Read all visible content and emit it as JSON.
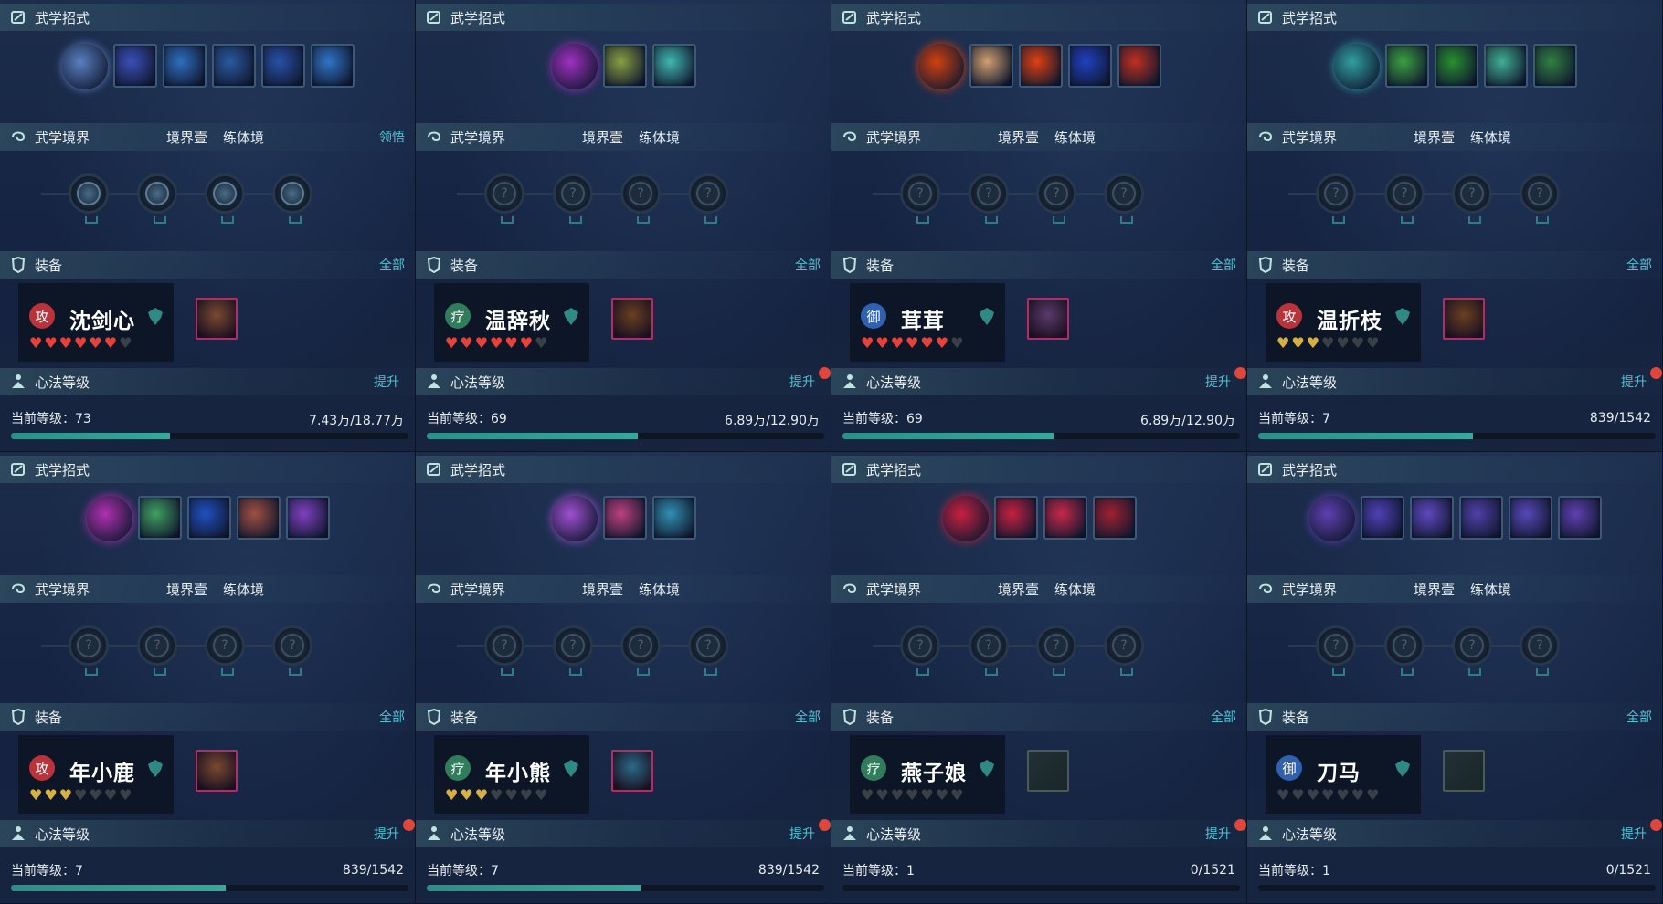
{
  "labels": {
    "wuxue_zhaoshi": "武学招式",
    "wuxue_jingjie": "武学境界",
    "realm_level": "境界壹",
    "realm_type": "练体境",
    "equipment": "装备",
    "all_link": "全部",
    "xinfa": "心法等级",
    "upgrade": "提升",
    "current_level_prefix": "当前等级："
  },
  "panels": [
    {
      "jingjie_link": "领悟",
      "skills": [
        "#5a7fc0",
        "#3b4fb8",
        "#2e6fc0",
        "#2a5aa0",
        "#2850a8",
        "#3075c8"
      ],
      "skill_icons": [
        "vortex-icon",
        "slash-icon",
        "whirl-icon",
        "blade-icon",
        "sword-icon",
        "strike-icon"
      ],
      "realm_nodes_unlocked": true,
      "character": {
        "name": "沈剑心",
        "badge": "攻",
        "badge_color": "#b8333a",
        "hearts": 6,
        "heart_total": 7,
        "heart_color": "#e8403a"
      },
      "gear_color": "#7a4a30",
      "level": "73",
      "exp": "7.43万/18.77万",
      "progress": 0.4,
      "red_dot": false
    },
    {
      "jingjie_link": "",
      "skills": [
        "#a030c0",
        "#88a040",
        "#40b8b0"
      ],
      "skill_icons": [
        "aura-icon",
        "burst-icon",
        "ring-icon"
      ],
      "realm_nodes_unlocked": false,
      "character": {
        "name": "温辞秋",
        "badge": "疗",
        "badge_color": "#2f7d5a",
        "hearts": 6,
        "heart_total": 7,
        "heart_color": "#e8403a"
      },
      "gear_color": "#6a4020",
      "level": "69",
      "exp": "6.89万/12.90万",
      "progress": 0.53,
      "red_dot": true
    },
    {
      "jingjie_link": "",
      "skills": [
        "#d04010",
        "#d0a070",
        "#e04010",
        "#2040c0",
        "#c03020"
      ],
      "skill_icons": [
        "flame-body-icon",
        "buddha-icon",
        "explosion-icon",
        "crescent-icon",
        "swirl-icon"
      ],
      "realm_nodes_unlocked": false,
      "character": {
        "name": "茸茸",
        "badge": "御",
        "badge_color": "#3060b0",
        "hearts": 6,
        "heart_total": 7,
        "heart_color": "#e8403a"
      },
      "gear_color": "#5a3a6a",
      "level": "69",
      "exp": "6.89万/12.90万",
      "progress": 0.53,
      "red_dot": true
    },
    {
      "jingjie_link": "",
      "skills": [
        "#30a0a0",
        "#3aa040",
        "#289030",
        "#40b090",
        "#308040"
      ],
      "skill_icons": [
        "guard-icon",
        "leaf-icon",
        "thorn-icon",
        "circle-icon",
        "yinyang-icon"
      ],
      "realm_nodes_unlocked": false,
      "character": {
        "name": "温折枝",
        "badge": "攻",
        "badge_color": "#b8333a",
        "hearts": 3,
        "heart_total": 7,
        "heart_color": "#d8b040"
      },
      "gear_color": "#6a4020",
      "level": "7",
      "exp": "839/1542",
      "progress": 0.54,
      "red_dot": true
    },
    {
      "jingjie_link": "",
      "skills": [
        "#b030b0",
        "#40a060",
        "#2050c0",
        "#a05040",
        "#8040c0"
      ],
      "skill_icons": [
        "rune-icon",
        "spark-icon",
        "wave-icon",
        "dragon-icon",
        "spirit-icon"
      ],
      "realm_nodes_unlocked": false,
      "character": {
        "name": "年小鹿",
        "badge": "攻",
        "badge_color": "#b8333a",
        "hearts": 3,
        "heart_total": 7,
        "heart_color": "#d8b040"
      },
      "gear_color": "#7a4a30",
      "level": "7",
      "exp": "839/1542",
      "progress": 0.54,
      "red_dot": true
    },
    {
      "jingjie_link": "",
      "skills": [
        "#a050d0",
        "#c04080",
        "#3090b0"
      ],
      "skill_icons": [
        "cone-icon",
        "serpent-icon",
        "shark-icon"
      ],
      "realm_nodes_unlocked": false,
      "character": {
        "name": "年小熊",
        "badge": "疗",
        "badge_color": "#2f7d5a",
        "hearts": 3,
        "heart_total": 7,
        "heart_color": "#d8b040"
      },
      "gear_color": "#2a6a8a",
      "level": "7",
      "exp": "839/1542",
      "progress": 0.54,
      "red_dot": true
    },
    {
      "jingjie_link": "",
      "skills": [
        "#c82040",
        "#c82040",
        "#c82848",
        "#a02030"
      ],
      "skill_icons": [
        "slash-red-icon",
        "slash-red-icon",
        "rose-icon",
        "warrior-icon"
      ],
      "realm_nodes_unlocked": false,
      "character": {
        "name": "燕子娘",
        "badge": "疗",
        "badge_color": "#2f7d5a",
        "hearts": 0,
        "heart_total": 7,
        "heart_color": "#d8b040"
      },
      "gear_color": "",
      "level": "1",
      "exp": "0/1521",
      "progress": 0,
      "red_dot": true
    },
    {
      "jingjie_link": "",
      "skills": [
        "#6040b0",
        "#5040b8",
        "#6048c0",
        "#5040a8",
        "#5848b8",
        "#6040b0"
      ],
      "skill_icons": [
        "blade-purple-icon",
        "cut-purple-icon",
        "slash-purple-icon",
        "ninja-purple-icon",
        "wind-purple-icon",
        "blade2-purple-icon"
      ],
      "realm_nodes_unlocked": false,
      "character": {
        "name": "刀马",
        "badge": "御",
        "badge_color": "#3060b0",
        "hearts": 0,
        "heart_total": 7,
        "heart_color": "#d8b040"
      },
      "gear_color": "",
      "level": "1",
      "exp": "0/1521",
      "progress": 0,
      "red_dot": true
    }
  ]
}
